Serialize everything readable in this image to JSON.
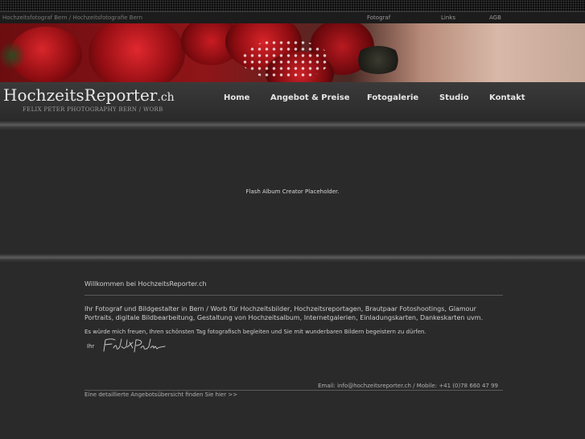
{
  "topbar": {
    "site_name": "Hochzeitsfotograf Bern / Hochzeitsfotografie Bern",
    "links": [
      "Fotograf",
      "Links",
      "AGB"
    ]
  },
  "logo": {
    "main": "HochzeitsReporter",
    "suffix": ".ch",
    "tagline": "FELIX PETER PHOTOGRAPHY BERN / WORB"
  },
  "nav": [
    "Home",
    "Angebot & Preise",
    "Fotogalerie",
    "Studio",
    "Kontakt"
  ],
  "flash": {
    "placeholder": "Flash Album Creator Placeholder."
  },
  "content": {
    "welcome": "Willkommen bei HochzeitsReporter.ch",
    "intro": "Ihr Fotograf und Bildgestalter in Bern / Worb für Hochzeitsbilder, Hochzeitsreportagen, Brautpaar Fotoshootings, Glamour Portraits, digitale Bildbearbeitung, Gestaltung von Hochzeitsalbum, Internetgalerien, Einladungskarten, Dankeskarten uvm.",
    "wish": "Es würde mich freuen, Ihren schönsten Tag fotografisch begleiten und Sie mit wunderbaren Bildern begeistern zu dürfen.",
    "ihr": "Ihr",
    "contact": "Email: info@hochzeitsreporter.ch   /   Mobile: +41 (0)78 660 47 99",
    "offer_link": "Eine detaillierte Angebotsübersicht finden Sie hier >>"
  },
  "colors": {
    "background": "#2a2a2a",
    "rose": "#b8151b",
    "text": "#cfcfcf"
  }
}
